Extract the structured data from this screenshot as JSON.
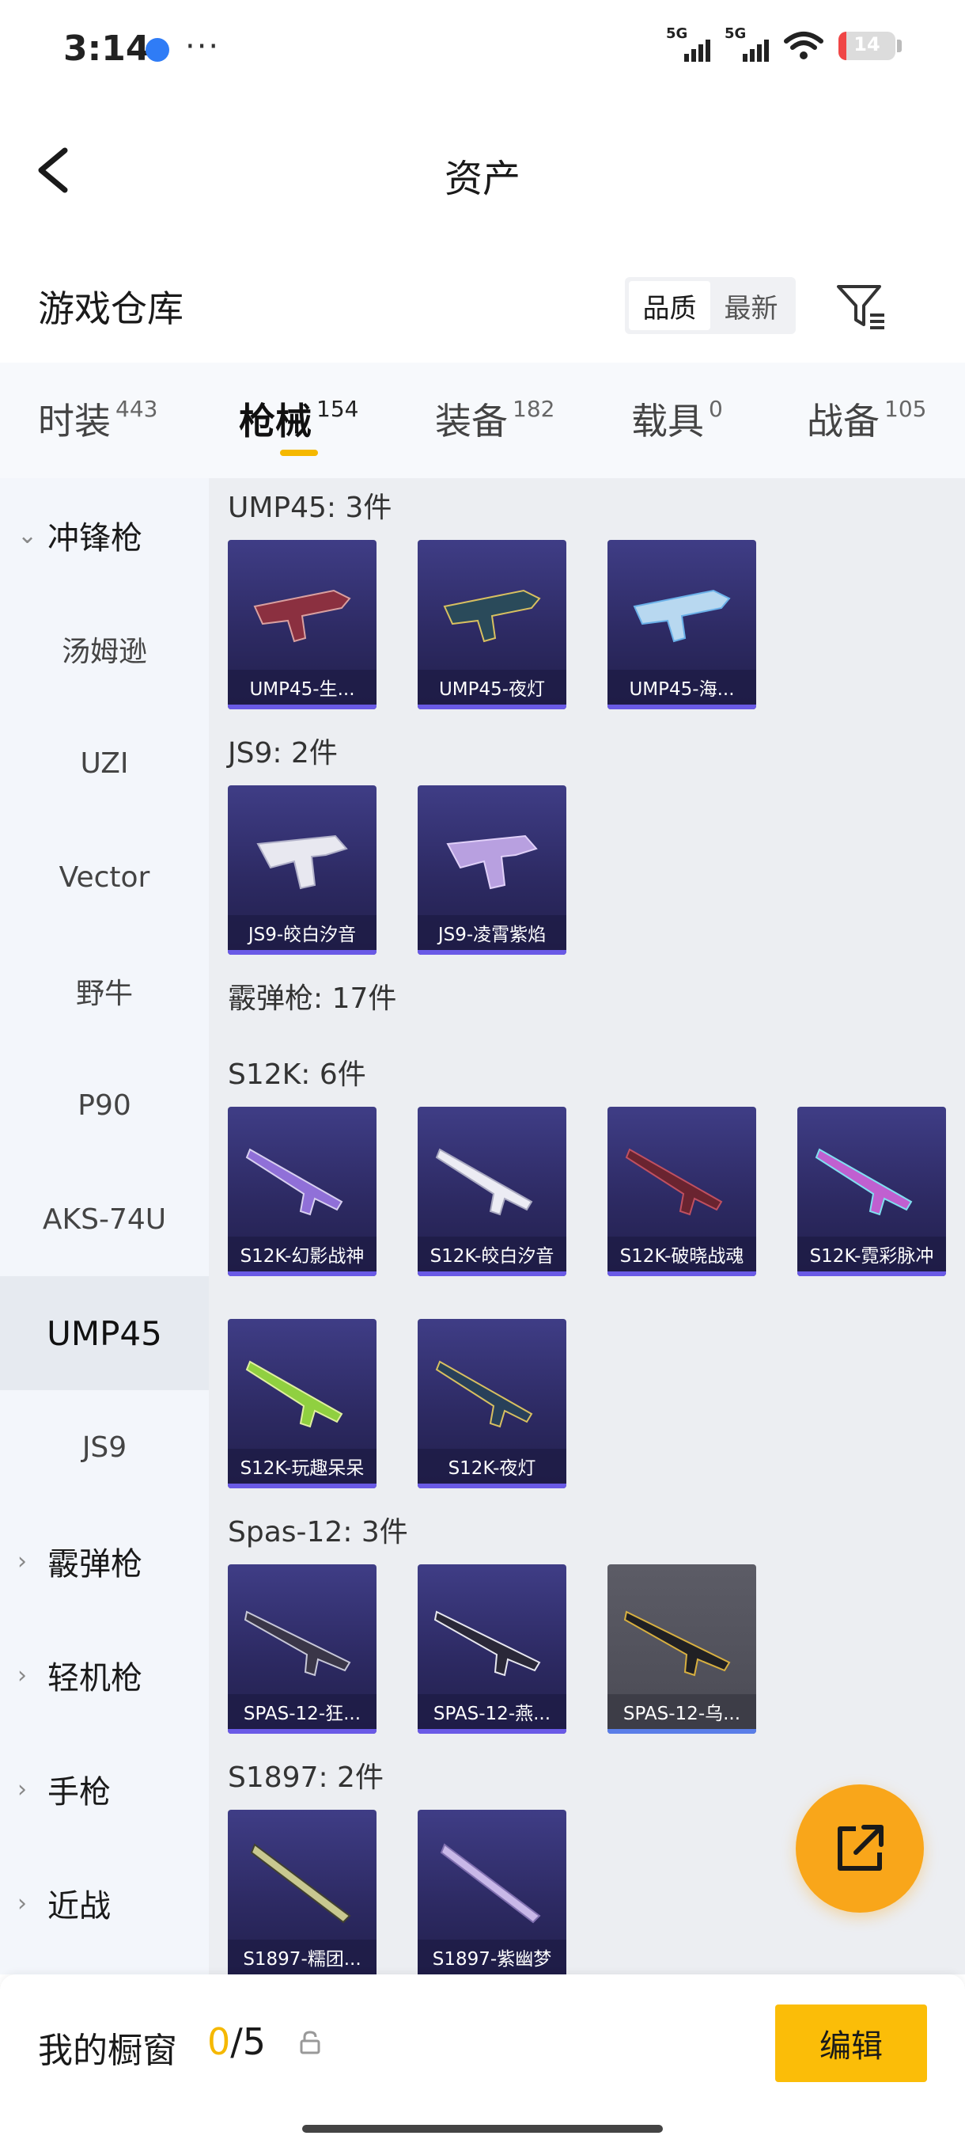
{
  "status_bar": {
    "time": "3:14",
    "more": "···",
    "signal1_label": "5G",
    "signal2_label": "5G",
    "battery": "14",
    "battery_level": 0.14,
    "battery_color": "#f04646"
  },
  "header": {
    "back_icon": "chevron-left-icon",
    "title": "资产"
  },
  "section": {
    "title": "游戏仓库",
    "sort_options": [
      "品质",
      "最新"
    ],
    "sort_selected": "品质",
    "filter_icon": "filter-icon"
  },
  "tabs": [
    {
      "label": "时装",
      "count": "443",
      "active": false
    },
    {
      "label": "枪械",
      "count": "154",
      "active": true
    },
    {
      "label": "装备",
      "count": "182",
      "active": false
    },
    {
      "label": "载具",
      "count": "0",
      "active": false
    },
    {
      "label": "战备",
      "count": "105",
      "active": false
    }
  ],
  "sidebar": {
    "items": [
      {
        "label": "冲锋枪",
        "type": "category",
        "expanded": true
      },
      {
        "label": "汤姆逊",
        "type": "sub"
      },
      {
        "label": "UZI",
        "type": "sub"
      },
      {
        "label": "Vector",
        "type": "sub"
      },
      {
        "label": "野牛",
        "type": "sub"
      },
      {
        "label": "P90",
        "type": "sub"
      },
      {
        "label": "AKS-74U",
        "type": "sub"
      },
      {
        "label": "UMP45",
        "type": "sub",
        "active": true
      },
      {
        "label": "JS9",
        "type": "sub"
      },
      {
        "label": "霰弹枪",
        "type": "category",
        "expanded": false
      },
      {
        "label": "轻机枪",
        "type": "category",
        "expanded": false
      },
      {
        "label": "手枪",
        "type": "category",
        "expanded": false
      },
      {
        "label": "近战",
        "type": "category",
        "expanded": false
      }
    ]
  },
  "content": {
    "groups": [
      {
        "label": "UMP45: 3件",
        "items": [
          "UMP45-生...",
          "UMP45-夜灯",
          "UMP45-海..."
        ]
      },
      {
        "label": "JS9: 2件",
        "items": [
          "JS9-皎白汐音",
          "JS9-凌霄紫焰"
        ]
      },
      {
        "label": "霰弹枪: 17件",
        "items": []
      },
      {
        "label": "S12K: 6件",
        "items": [
          "S12K-幻影战神",
          "S12K-皎白汐音",
          "S12K-破晓战魂",
          "S12K-霓彩脉冲",
          "S12K-玩趣呆呆",
          "S12K-夜灯"
        ]
      },
      {
        "label": "Spas-12: 3件",
        "items": [
          "SPAS-12-狂...",
          "SPAS-12-燕...",
          "SPAS-12-乌..."
        ]
      },
      {
        "label": "S1897: 2件",
        "items": [
          "S1897-糯团...",
          "S1897-紫幽梦"
        ]
      }
    ]
  },
  "fab": {
    "icon": "share-external-icon"
  },
  "bottom_bar": {
    "label": "我的橱窗",
    "current": "0",
    "total": "/5",
    "lock_icon": "lock-icon",
    "edit_label": "编辑"
  },
  "colors": {
    "accent": "#f5b800",
    "fab": "#f9a61a",
    "edit_button": "#fbbd08",
    "card_bg": "#2d2a63"
  }
}
